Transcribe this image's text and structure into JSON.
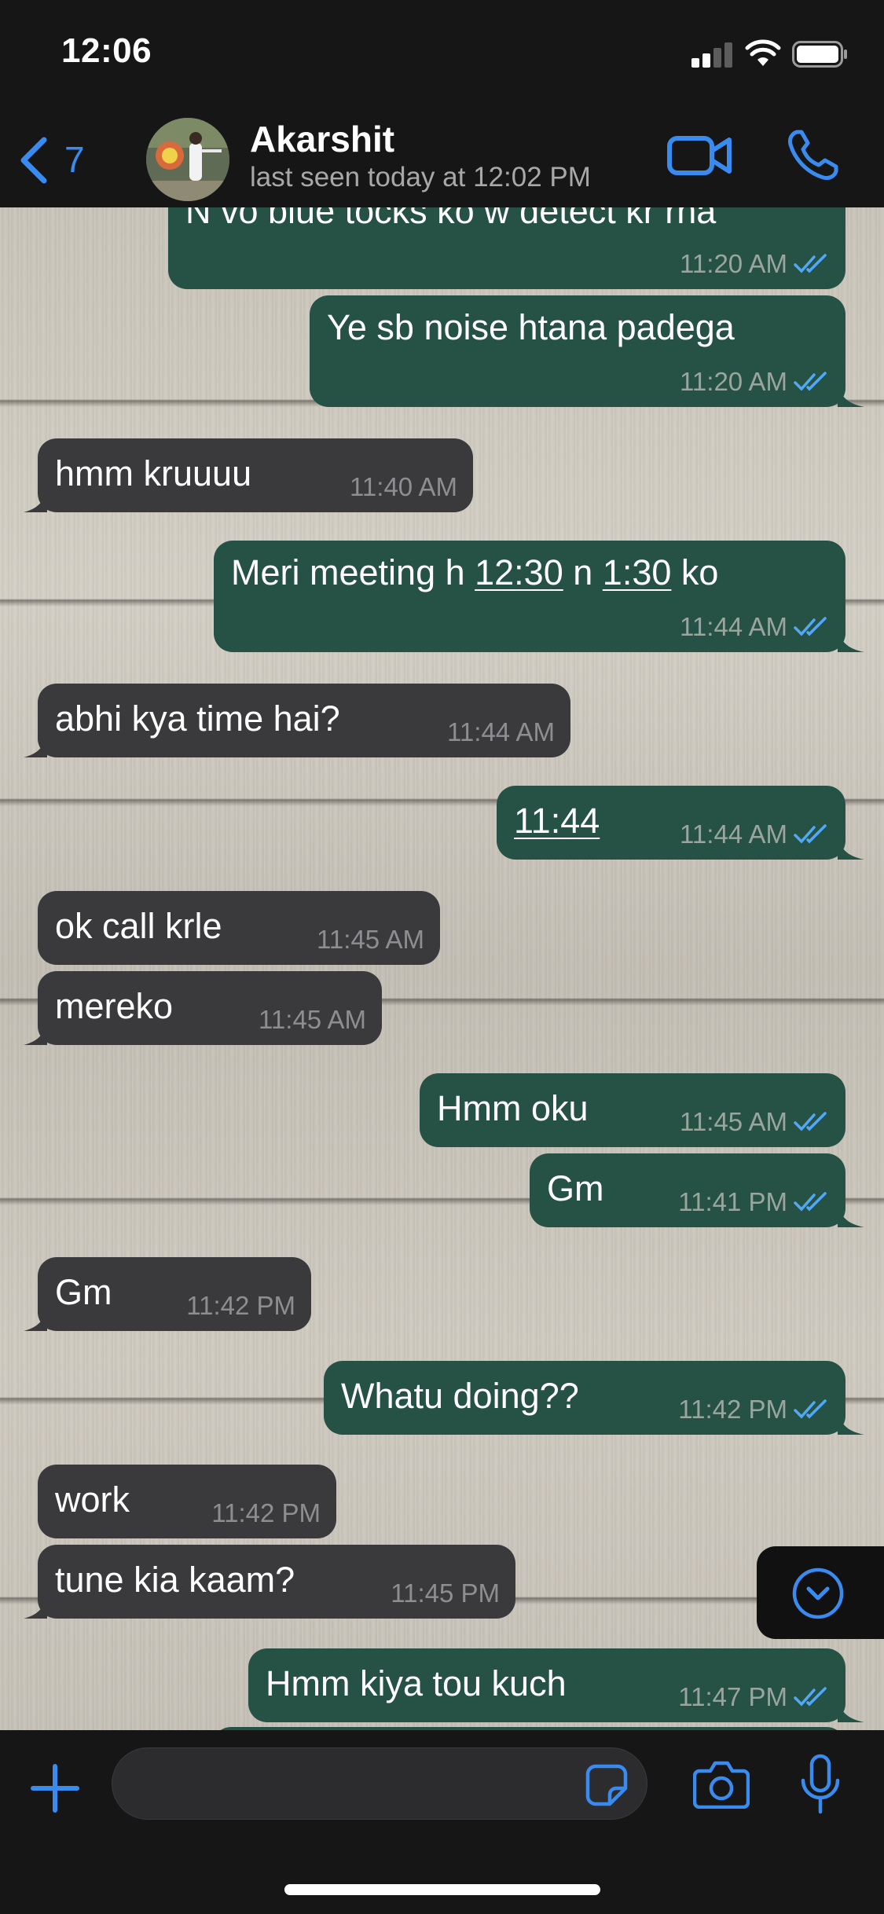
{
  "status_bar": {
    "time": "12:06"
  },
  "header": {
    "back_count": "7",
    "contact_name": "Akarshit",
    "last_seen": "last seen today at 12:02 PM"
  },
  "colors": {
    "accent": "#3a8bf0",
    "outgoing_bubble": "#265246",
    "incoming_bubble": "#3a3a3c",
    "read_ticks": "#53a8f5"
  },
  "messages": [
    {
      "direction": "outgoing",
      "text": "N vo blue tocks ko w detect kr rha",
      "time": "11:20 AM"
    },
    {
      "direction": "outgoing",
      "text": "Ye sb noise htana padega",
      "time": "11:20 AM"
    },
    {
      "direction": "incoming",
      "text": "hmm kruuuu",
      "time": "11:40 AM"
    },
    {
      "direction": "outgoing",
      "text_parts": [
        "Meri meeting h ",
        "12:30",
        " n ",
        "1:30",
        " ko"
      ],
      "time": "11:44 AM"
    },
    {
      "direction": "incoming",
      "text": "abhi kya time hai?",
      "time": "11:44 AM"
    },
    {
      "direction": "outgoing",
      "text": "11:44",
      "time": "11:44 AM"
    },
    {
      "direction": "incoming",
      "text": "ok call krle",
      "time": "11:45 AM"
    },
    {
      "direction": "incoming",
      "text": "mereko",
      "time": "11:45 AM"
    },
    {
      "direction": "outgoing",
      "text": "Hmm oku",
      "time": "11:45 AM"
    },
    {
      "direction": "outgoing",
      "text": "Gm",
      "time": "11:41 PM"
    },
    {
      "direction": "incoming",
      "text": "Gm",
      "time": "11:42 PM"
    },
    {
      "direction": "outgoing",
      "text": "Whatu doing??",
      "time": "11:42 PM"
    },
    {
      "direction": "incoming",
      "text": "work",
      "time": "11:42 PM"
    },
    {
      "direction": "incoming",
      "text": "tune kia kaam?",
      "time": "11:45 PM"
    },
    {
      "direction": "outgoing",
      "text": "Hmm kiya tou kuch",
      "time": "11:47 PM"
    }
  ],
  "icons": {
    "back": "chevron-left-icon",
    "video": "video-camera-icon",
    "phone": "phone-icon",
    "scroll": "chevron-down-circle-icon",
    "attach": "plus-icon",
    "sticker": "sticker-icon",
    "camera": "camera-icon",
    "mic": "microphone-icon"
  }
}
